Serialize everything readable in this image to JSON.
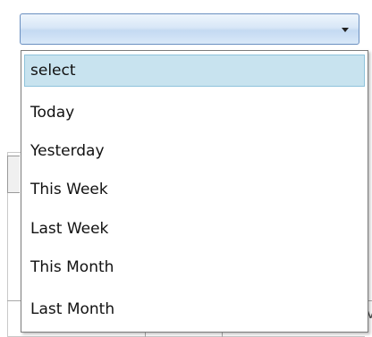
{
  "select": {
    "current_value": "",
    "options": [
      "select",
      "Today",
      "Yesterday",
      "This Week",
      "Last Week",
      "This Month",
      "Last Month"
    ],
    "highlighted_option": "select"
  },
  "colors": {
    "select_border": "#6a8fc0",
    "highlight_bg": "#c8e3ef",
    "highlight_border": "#8fc3db"
  },
  "icons": {
    "dropdown_arrow": "chevron-down-icon"
  },
  "background": {
    "right_glyph": "V"
  }
}
